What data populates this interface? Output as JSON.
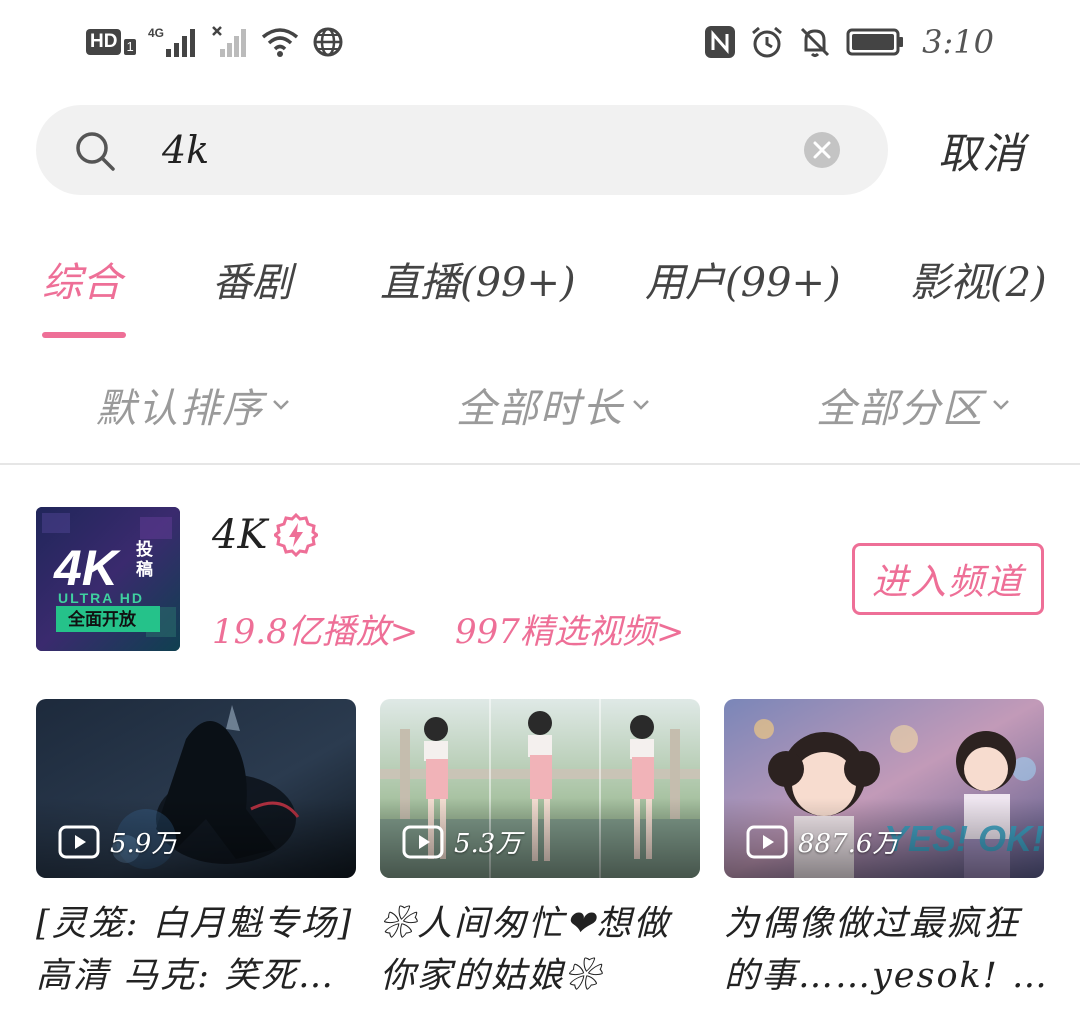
{
  "status_bar": {
    "hd_label": "HD",
    "hd_sub": "1",
    "network_label": "4G",
    "time": "3:10"
  },
  "search": {
    "query": "4k",
    "placeholder": "",
    "cancel_label": "取消"
  },
  "tabs": [
    {
      "label": "综合",
      "active": true
    },
    {
      "label": "番剧",
      "active": false
    },
    {
      "label": "直播(99+)",
      "active": false
    },
    {
      "label": "用户(99+)",
      "active": false
    },
    {
      "label": "影视(2)",
      "active": false
    }
  ],
  "filters": [
    {
      "label": "默认排序"
    },
    {
      "label": "全部时长"
    },
    {
      "label": "全部分区"
    }
  ],
  "channel": {
    "name": "4K",
    "thumb_big": "4K",
    "thumb_side": "投稿",
    "thumb_ultra": "ULTRA HD",
    "thumb_banner": "全面开放",
    "plays": "19.8亿播放>",
    "featured": "997精选视频>",
    "enter_label": "进入频道"
  },
  "videos": [
    {
      "views": "5.9万",
      "title_line1": "[灵笼: 白月魁专场]",
      "title_line2": "高清  马克: 笑死…"
    },
    {
      "views": "5.3万",
      "title_line1": "❀人间匆忙❤想做",
      "title_line2": "你家的姑娘❀"
    },
    {
      "views": "887.6万",
      "title_line1": "为偶像做过最疯狂",
      "title_line2": "的事……yesok! …"
    }
  ],
  "colors": {
    "accent": "#ee6f97",
    "muted_text": "#9a9a9a",
    "search_bg": "#f1f1f1"
  }
}
